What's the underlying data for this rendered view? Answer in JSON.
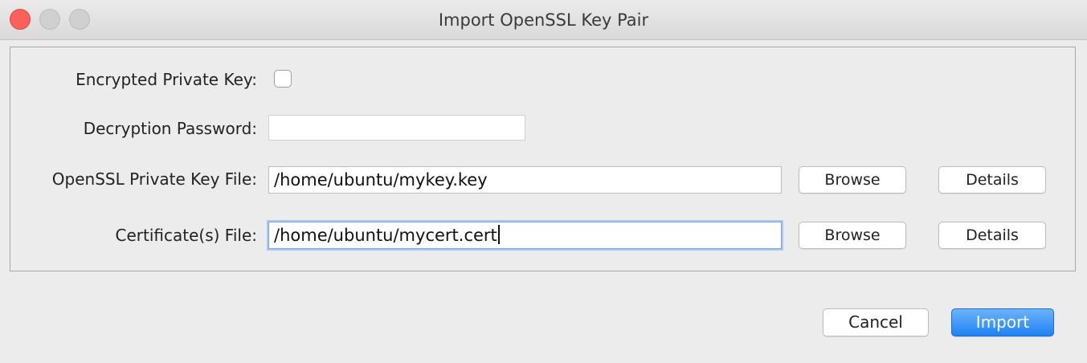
{
  "window": {
    "title": "Import OpenSSL Key Pair"
  },
  "form": {
    "encrypted_label": "Encrypted Private Key:",
    "encrypted_checked": false,
    "password_label": "Decryption Password:",
    "password_value": "",
    "key_file_label": "OpenSSL Private Key File:",
    "key_file_value": "/home/ubuntu/mykey.key",
    "cert_file_label": "Certificate(s) File:",
    "cert_file_value": "/home/ubuntu/mycert.cert",
    "browse_label": "Browse",
    "details_label": "Details"
  },
  "actions": {
    "cancel_label": "Cancel",
    "import_label": "Import"
  },
  "colors": {
    "accent": "#1e82f5",
    "close": "#fc605b"
  }
}
